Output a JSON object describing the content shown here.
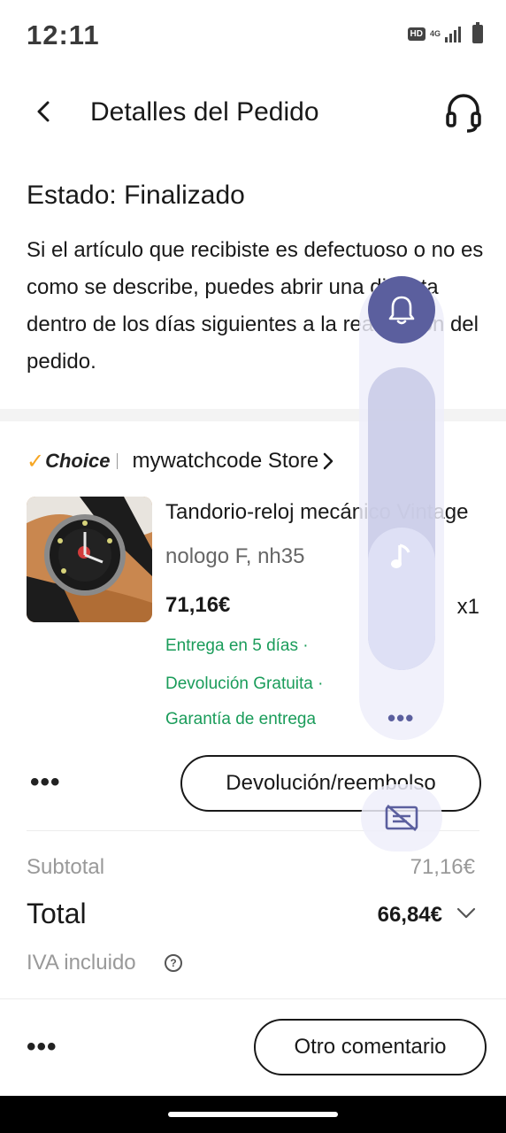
{
  "status_bar": {
    "time": "12:11",
    "hd_badge": "HD",
    "network_label": "4G"
  },
  "header": {
    "title": "Detalles del Pedido"
  },
  "order": {
    "status_title": "Estado: Finalizado",
    "status_message": "Si el artículo que recibiste es defectuoso o no es como se describe, puedes abrir una disputa dentro de los días siguientes a la realización del pedido."
  },
  "store": {
    "badge_check": "✓",
    "badge_label": "Choice",
    "name": "mywatchcode Store"
  },
  "product": {
    "title": "Tandorio-reloj mecánico Vintage",
    "variant": "nologo F, nh35",
    "price": "71,16€",
    "quantity": "x1",
    "shipping_lines": [
      "Entrega en 5 días ·",
      "Devolución Gratuita ·",
      "Garantía de entrega"
    ]
  },
  "actions": {
    "more_label": "•••",
    "return_button": "Devolución/reembolso"
  },
  "summary": {
    "subtotal_label": "Subtotal",
    "subtotal_value": "71,16€",
    "total_label": "Total",
    "total_value": "66,84€",
    "tax_label": "IVA incluido",
    "help_glyph": "?"
  },
  "footer": {
    "more_label": "•••",
    "comment_button": "Otro comentario"
  },
  "overlay": {
    "more_label": "•••",
    "volume_level": 0.47
  },
  "colors": {
    "accent_green": "#1a9c5a",
    "choice_orange": "#f6a623",
    "overlay_purple": "#5b5f9e"
  }
}
